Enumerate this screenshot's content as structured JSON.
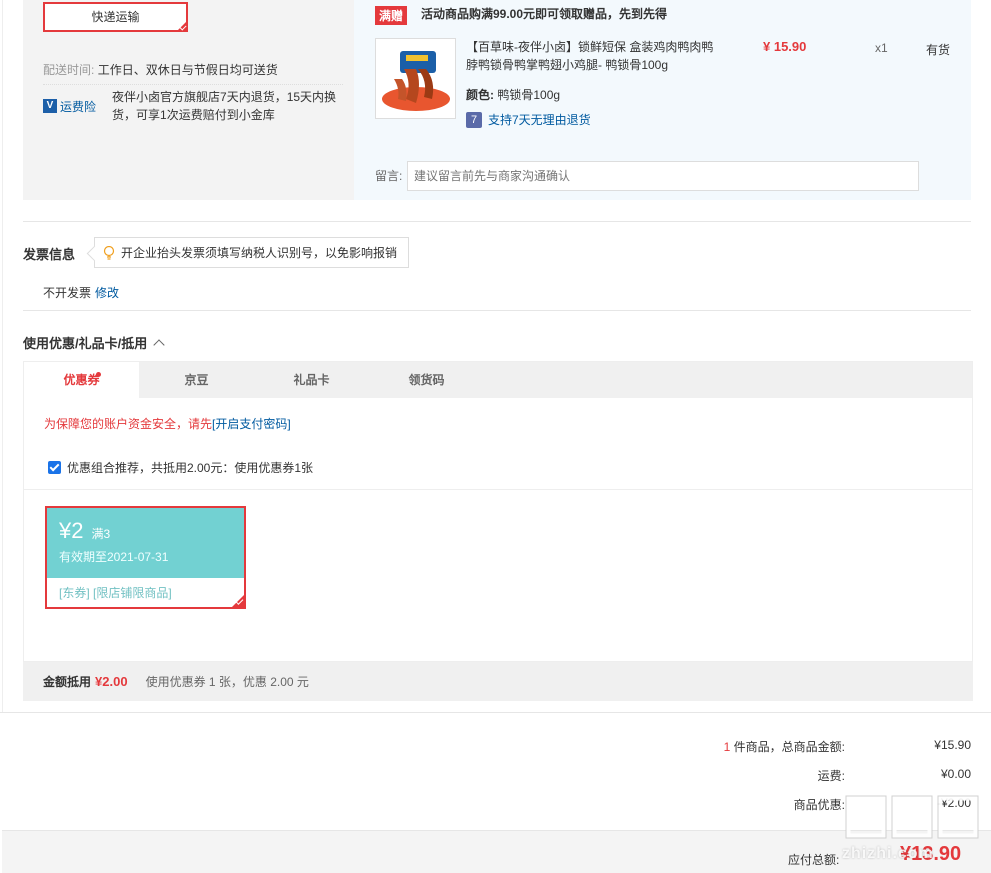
{
  "delivery": {
    "shipping_method": "快递运输",
    "time_label": "配送时间:",
    "time_value": "工作日、双休日与节假日均可送货",
    "insurance_label": "运费险",
    "insurance_desc": "夜伴小卤官方旗舰店7天内退货，15天内换货，可享1次运费赔付到小金库"
  },
  "gift": {
    "tag": "满赠",
    "text": "活动商品购满99.00元即可领取赠品，先到先得"
  },
  "item": {
    "name": "【百草味-夜伴小卤】锁鲜短保 盒装鸡肉鸭肉鸭脖鸭锁骨鸭掌鸭翅小鸡腿- 鸭锁骨100g",
    "price": "¥ 15.90",
    "qty": "x1",
    "stock": "有货",
    "color_label": "颜色:",
    "color_value": "鸭锁骨100g",
    "return_icon": "7",
    "return_text": "支持7天无理由退货"
  },
  "remark": {
    "label": "留言:",
    "placeholder": "建议留言前先与商家沟通确认"
  },
  "invoice": {
    "title": "发票信息",
    "tip": "开企业抬头发票须填写纳税人识别号，以免影响报销",
    "status": "不开发票",
    "edit": "修改"
  },
  "coupons": {
    "title": "使用优惠/礼品卡/抵用",
    "tabs": [
      {
        "label": "优惠券",
        "active": true
      },
      {
        "label": "京豆",
        "active": false
      },
      {
        "label": "礼品卡",
        "active": false
      },
      {
        "label": "领货码",
        "active": false
      }
    ],
    "security_text": "为保障您的账户资金安全，请先",
    "security_link": "[开启支付密码]",
    "combo_text": "优惠组合推荐，共抵用2.00元：使用优惠券1张",
    "card": {
      "amount": "¥2",
      "condition": "满3",
      "expire": "有效期至2021-07-31",
      "tags": "[东券] [限店铺限商品]"
    },
    "summary_label": "金额抵用",
    "summary_value": "¥2.00",
    "summary_desc": "使用优惠券 1 张，优惠 2.00 元"
  },
  "totals": {
    "count": "1",
    "count_suffix": " 件商品，总商品金额:",
    "goods_amount": "¥15.90",
    "freight_label": "运费:",
    "freight_value": "¥0.00",
    "discount_label": "商品优惠:",
    "discount_value": "-¥2.00",
    "pay_label": "应付总额:",
    "pay_value": "¥13.90"
  },
  "watermark": "zhizhi.com",
  "colors": {
    "accent": "#e4393c",
    "link": "#005aa0",
    "coupon": "#72d1d2"
  }
}
